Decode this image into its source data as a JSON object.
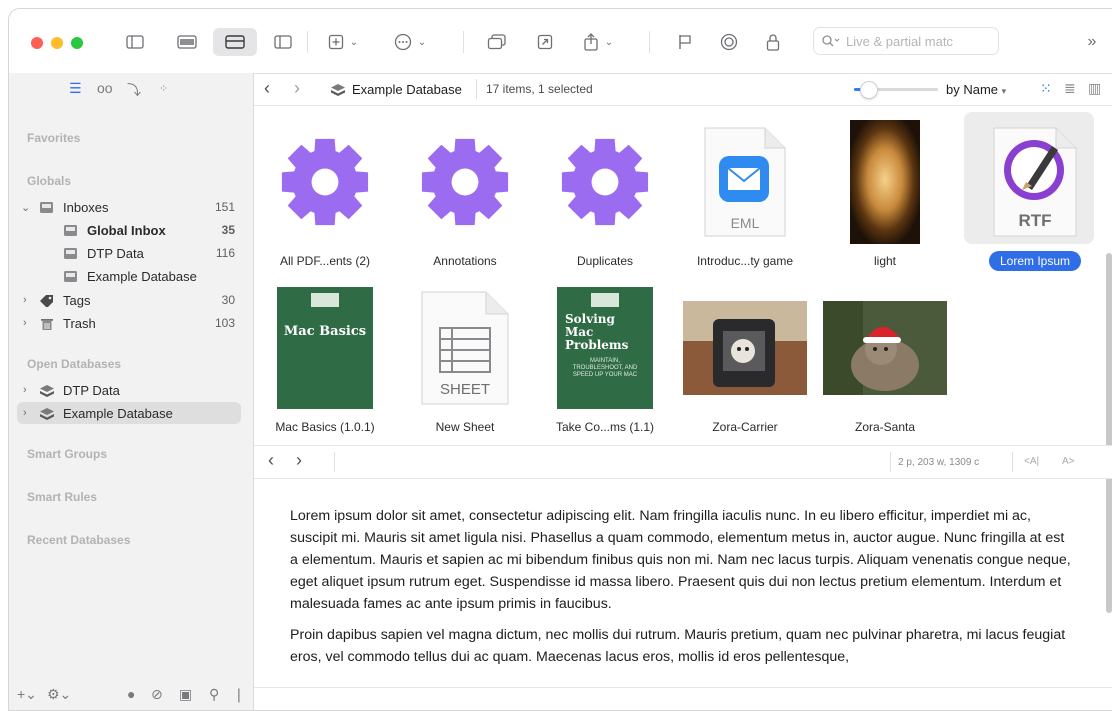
{
  "toolbar": {
    "search_placeholder": "Live & partial matc",
    "colors": {
      "close": "#ff5f57",
      "minimize": "#febc2e",
      "zoom": "#28c840"
    }
  },
  "sidebar": {
    "sections": {
      "favorites": "Favorites",
      "globals": "Globals",
      "open_databases": "Open Databases",
      "smart_groups": "Smart Groups",
      "smart_rules": "Smart Rules",
      "recent_databases": "Recent Databases"
    },
    "globals": [
      {
        "label": "Inboxes",
        "count": "151"
      },
      {
        "label": "Global Inbox",
        "count": "35"
      },
      {
        "label": "DTP Data",
        "count": "116"
      },
      {
        "label": "Example Database",
        "count": ""
      },
      {
        "label": "Tags",
        "count": "30"
      },
      {
        "label": "Trash",
        "count": "103"
      }
    ],
    "databases": [
      {
        "label": "DTP Data"
      },
      {
        "label": "Example Database"
      }
    ]
  },
  "pathbar": {
    "crumb": "Example Database",
    "count": "17 items, 1 selected",
    "sort": "by Name",
    "zoom_fraction": 0.1
  },
  "items": [
    {
      "caption": "All PDF...ents (2)",
      "kind": "smart-group"
    },
    {
      "caption": "Annotations",
      "kind": "smart-group"
    },
    {
      "caption": "Duplicates",
      "kind": "smart-group"
    },
    {
      "caption": "Introduc...ty game",
      "kind": "eml",
      "badge": "EML"
    },
    {
      "caption": "light",
      "kind": "image"
    },
    {
      "caption": "Lorem Ipsum",
      "kind": "rtf",
      "badge": "RTF"
    },
    {
      "caption": "Mac Basics (1.0.1)",
      "kind": "book",
      "cover": "Mac Basics"
    },
    {
      "caption": "New Sheet",
      "kind": "sheet",
      "badge": "SHEET"
    },
    {
      "caption": "Take Co...ms (1.1)",
      "kind": "book",
      "cover": "Solving Mac Problems",
      "cover_sub": "MAINTAIN, TROUBLESHOOT, AND SPEED UP YOUR MAC"
    },
    {
      "caption": "Zora-Carrier",
      "kind": "photo"
    },
    {
      "caption": "Zora-Santa",
      "kind": "photo"
    }
  ],
  "pane": {
    "stats": "2 p, 203 w, 1309 c",
    "font_smaller": "<A|",
    "font_larger": "A>",
    "paragraphs": [
      "Lorem ipsum dolor sit amet, consectetur adipiscing elit. Nam fringilla iaculis nunc. In eu libero efficitur, imperdiet mi ac, suscipit mi. Mauris sit amet ligula nisi. Phasellus a quam commodo, elementum metus in, auctor augue. Nunc fringilla at est a elementum. Mauris et sapien ac mi bibendum finibus quis non mi. Nam nec lacus turpis. Aliquam venenatis congue neque, eget aliquet ipsum rutrum eget. Suspendisse id massa libero. Praesent quis dui non lectus pretium elementum. Interdum et malesuada fames ac ante ipsum primis in faucibus.",
      "Proin dapibus sapien vel magna dictum, nec mollis dui rutrum. Mauris pretium, quam nec pulvinar pharetra, mi lacus feugiat eros, vel commodo tellus dui ac quam. Maecenas lacus eros, mollis id eros pellentesque,"
    ]
  },
  "colors": {
    "accent": "#2f6ee6",
    "gear": "#9b6bf0",
    "book_green": "#2f6b45"
  }
}
